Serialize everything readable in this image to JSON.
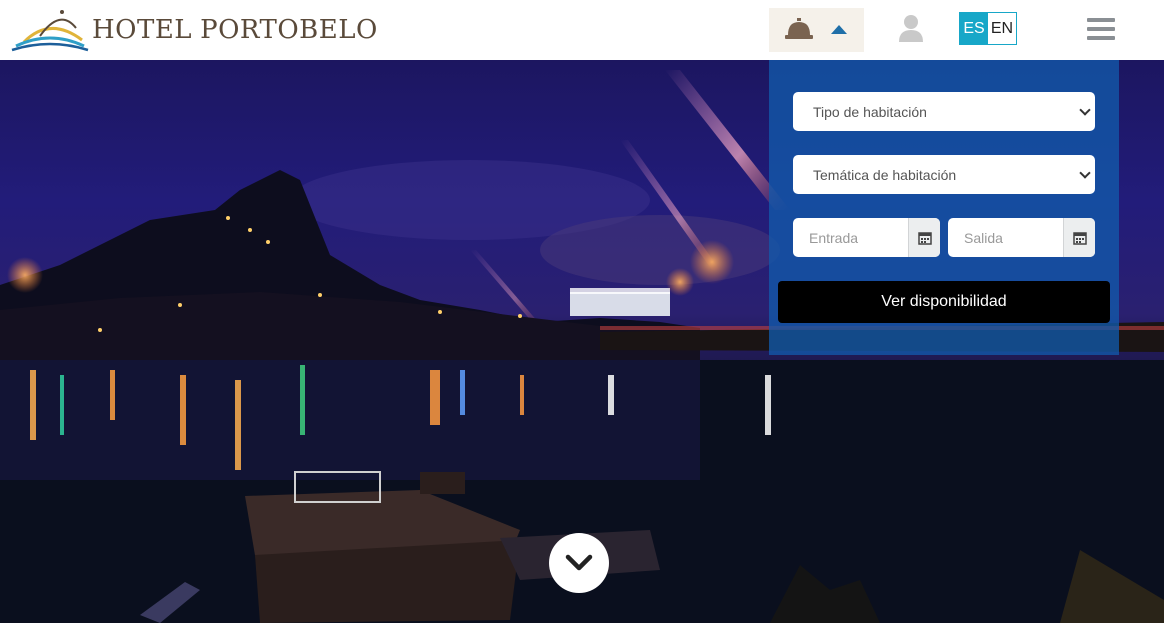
{
  "header": {
    "logo_word1": "HOTEL",
    "logo_word2": "PORTOBELO",
    "bell_icon": "reception-bell-icon",
    "toggle_icon": "caret-up-icon",
    "user_icon": "user-icon",
    "languages": {
      "active": "ES",
      "other": "EN"
    },
    "menu_icon": "hamburger-icon"
  },
  "booking": {
    "room_type_placeholder": "Tipo de habitación",
    "room_theme_placeholder": "Temática de habitación",
    "checkin_placeholder": "Entrada",
    "checkout_placeholder": "Salida",
    "calendar_icon": "calendar-icon",
    "submit_label": "Ver disponibilidad"
  },
  "hero": {
    "scroll_icon": "chevron-down-icon"
  },
  "colors": {
    "accent": "#17a7c8",
    "panel": "#125aaa",
    "caret": "#1f6fa8",
    "logo_text": "#5a4a3a",
    "button": "#000000"
  }
}
